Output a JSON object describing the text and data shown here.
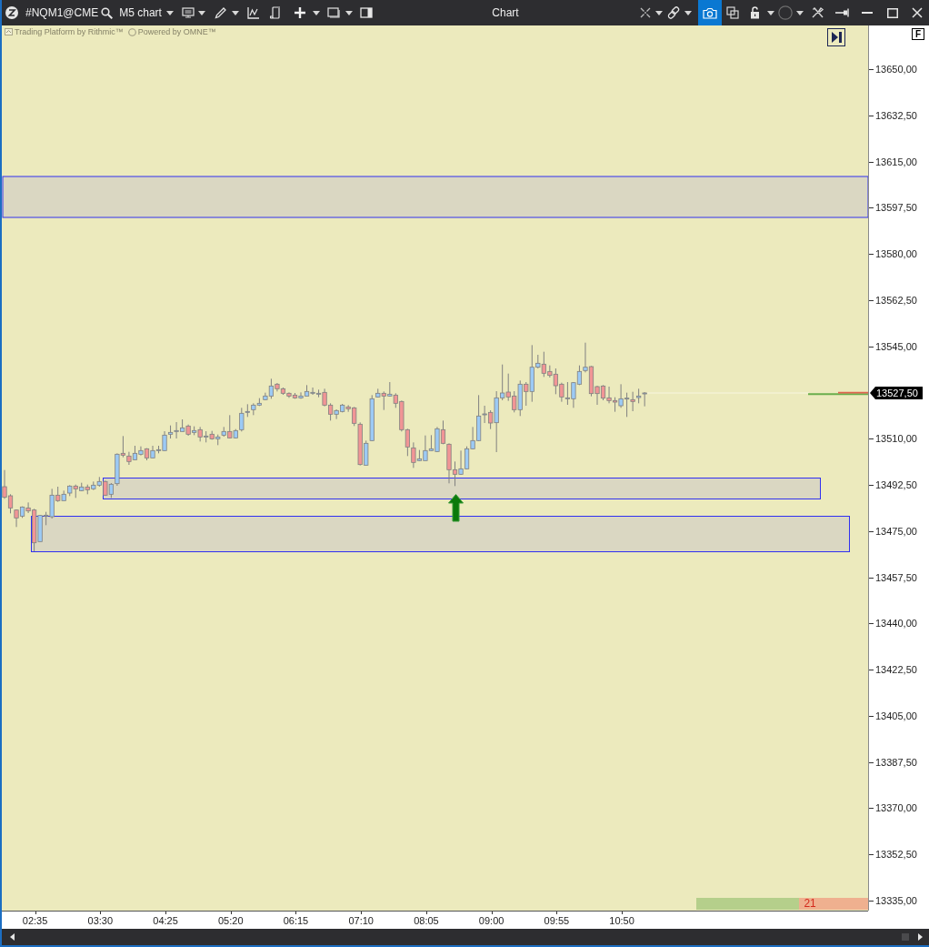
{
  "window": {
    "title": "Chart"
  },
  "toolbar": {
    "symbol": "#NQM1@CME",
    "chart_template": "M5 chart",
    "capture_button": {
      "on": true
    }
  },
  "chart": {
    "credits": [
      "Trading Platform by Rithmic™",
      "Powered by OMNE™"
    ],
    "last_price": "13527,50",
    "ratio_bar": {
      "label": "21",
      "level": 0.6
    }
  },
  "price_axis": {
    "mode_button": "F",
    "labels_above_last_price": [
      "13650,00",
      "13632,50",
      "13615,00",
      "13597,50",
      "13580,00",
      "13562,50",
      "13545,00"
    ],
    "labels_below_last_price": [
      "13510,00",
      "13492,50",
      "13475,00",
      "13457,50",
      "13440,00",
      "13422,50",
      "13405,00",
      "13387,50",
      "13370,00",
      "13352,50",
      "13335,00"
    ]
  },
  "time_axis": {
    "labels": [
      "02:35",
      "03:30",
      "04:25",
      "05:20",
      "06:15",
      "07:10",
      "08:05",
      "09:00",
      "09:55",
      "10:50"
    ]
  }
}
